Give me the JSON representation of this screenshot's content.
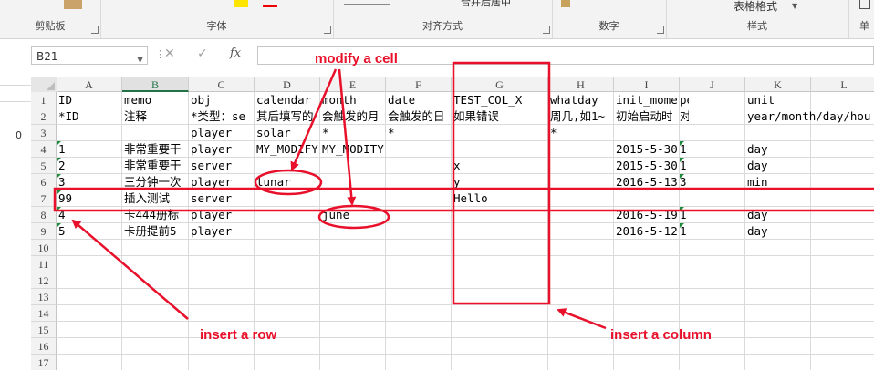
{
  "ribbon": {
    "groups": [
      {
        "label": "剪贴板"
      },
      {
        "label": "字体"
      },
      {
        "label": "对齐方式"
      },
      {
        "label": "数字"
      },
      {
        "label": "样式"
      }
    ],
    "table_format_label": "表格格式",
    "merge_center_label": "合并后居中",
    "right_edge_label": "单"
  },
  "formula_bar": {
    "name_box": "B21",
    "cancel_label": "✕",
    "enter_label": "✓",
    "fx_label": "fx",
    "formula": ""
  },
  "outline_level": "0",
  "columns": [
    "A",
    "B",
    "C",
    "D",
    "E",
    "F",
    "G",
    "H",
    "I",
    "J",
    "K",
    "L"
  ],
  "selected_column": "B",
  "rows": [
    "1",
    "2",
    "3",
    "4",
    "5",
    "6",
    "7",
    "8",
    "9",
    "10",
    "11",
    "12",
    "13",
    "14",
    "15",
    "16",
    "17"
  ],
  "cells": {
    "r1": {
      "A": "ID",
      "B": "memo",
      "C": "obj",
      "D": "calendar",
      "E": "month",
      "F": "date",
      "G": "TEST_COL_X",
      "H": "whatday",
      "I": "init_mome",
      "J": "period",
      "K": "unit"
    },
    "r2": {
      "A": "*ID",
      "B": "注释",
      "C": "*类型：se",
      "D": "其后填写的",
      "E": "会触发的月",
      "F": "会触发的日",
      "G": "如果错误",
      "H": "周几,如1~",
      "I": "初始启动时",
      "J": "对应调用周",
      "K": "year/month/day/hou"
    },
    "r3": {
      "C": "player",
      "D": "solar",
      "E": "*",
      "F": "*",
      "H": "*"
    },
    "r4": {
      "A": "1",
      "B": "非常重要干",
      "C": "player",
      "D": "MY_MODIFY",
      "E": "MY_MODITY",
      "I": "2015-5-30",
      "J": "1",
      "K": "day"
    },
    "r5": {
      "A": "2",
      "B": "非常重要干",
      "C": "server",
      "G": "x",
      "I": "2015-5-30",
      "J": "1",
      "K": "day"
    },
    "r6": {
      "A": "3",
      "B": "三分钟一次",
      "C": "player",
      "D": "lunar",
      "G": "y",
      "I": "2016-5-13",
      "J": "3",
      "K": "min"
    },
    "r7": {
      "A": "99",
      "B": "插入测试",
      "C": "server",
      "G": "Hello"
    },
    "r8": {
      "A": "4",
      "B": "卡444册标",
      "C": "player",
      "E": "june",
      "I": "2016-5-19",
      "J": "1",
      "K": "day"
    },
    "r9": {
      "A": "5",
      "B": "卡册提前5",
      "C": "player",
      "I": "2016-5-12",
      "J": "1",
      "K": "day"
    }
  },
  "annotations": {
    "modify": "modify a cell",
    "insert_row": "insert a row",
    "insert_column": "insert a column"
  },
  "colors": {
    "annotation": "#e8102a",
    "excel_green": "#217346"
  }
}
